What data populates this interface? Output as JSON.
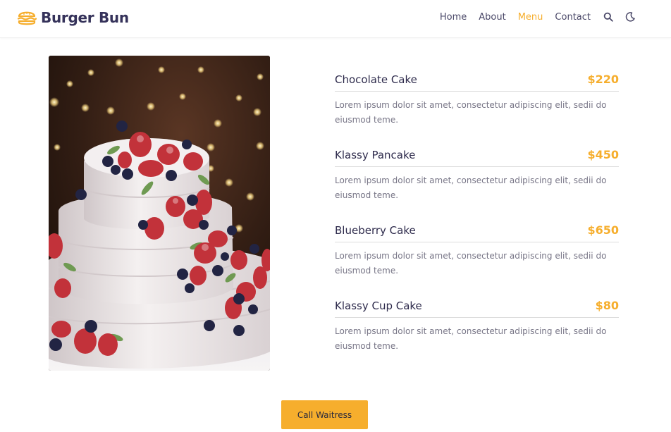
{
  "brand": {
    "name": "Burger Bun",
    "accent": "#f6ae2d",
    "text_color": "#35325a"
  },
  "nav": {
    "items": [
      {
        "label": "Home",
        "active": false
      },
      {
        "label": "About",
        "active": false
      },
      {
        "label": "Menu",
        "active": true
      },
      {
        "label": "Contact",
        "active": false
      }
    ],
    "icons": [
      "search-icon",
      "moon-icon"
    ]
  },
  "photo": {
    "subject": "cake-with-berries-icon"
  },
  "menu": {
    "items": [
      {
        "name": "Chocolate Cake",
        "price": "$220",
        "description": "Lorem ipsum dolor sit amet, consectetur adipiscing elit, sedii do eiusmod teme."
      },
      {
        "name": "Klassy Pancake",
        "price": "$450",
        "description": "Lorem ipsum dolor sit amet, consectetur adipiscing elit, sedii do eiusmod teme."
      },
      {
        "name": "Blueberry Cake",
        "price": "$650",
        "description": "Lorem ipsum dolor sit amet, consectetur adipiscing elit, sedii do eiusmod teme."
      },
      {
        "name": "Klassy Cup Cake",
        "price": "$80",
        "description": "Lorem ipsum dolor sit amet, consectetur adipiscing elit, sedii do eiusmod teme."
      }
    ]
  },
  "cta": {
    "label": "Call Waitress"
  }
}
